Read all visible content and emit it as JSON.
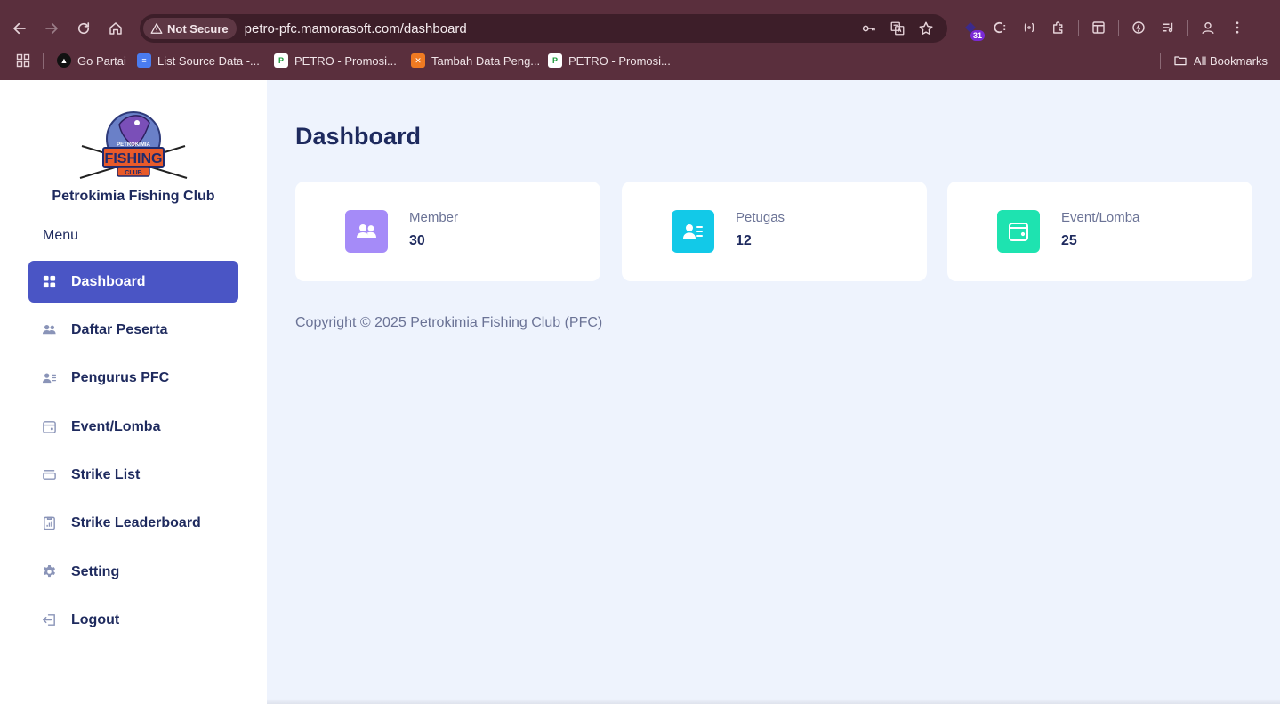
{
  "browser": {
    "security_label": "Not Secure",
    "url": "petro-pfc.mamorasoft.com/dashboard",
    "extension_badge": "31",
    "bookmarks": [
      {
        "label": "Go Partai",
        "favicon": "black-circle-icon",
        "color": "#111111"
      },
      {
        "label": "List Source Data -...",
        "favicon": "google-docs-icon",
        "color": "#4a7cf0"
      },
      {
        "label": "PETRO - Promosi...",
        "favicon": "petro-logo-icon",
        "color": "#ffffff"
      },
      {
        "label": "Tambah Data Peng...",
        "favicon": "xampp-icon",
        "color": "#f07a22"
      },
      {
        "label": "PETRO - Promosi...",
        "favicon": "petro-logo-icon",
        "color": "#ffffff"
      }
    ],
    "all_bookmarks_label": "All Bookmarks"
  },
  "sidebar": {
    "brand": "Petrokimia Fishing Club",
    "menu_label": "Menu",
    "items": [
      {
        "label": "Dashboard",
        "icon": "grid-icon"
      },
      {
        "label": "Daftar Peserta",
        "icon": "users-icon"
      },
      {
        "label": "Pengurus PFC",
        "icon": "id-card-icon"
      },
      {
        "label": "Event/Lomba",
        "icon": "calendar-icon"
      },
      {
        "label": "Strike List",
        "icon": "list-icon"
      },
      {
        "label": "Strike Leaderboard",
        "icon": "clipboard-chart-icon"
      },
      {
        "label": "Setting",
        "icon": "gear-icon"
      },
      {
        "label": "Logout",
        "icon": "logout-icon"
      }
    ],
    "active_item": "Dashboard"
  },
  "main": {
    "title": "Dashboard",
    "cards": [
      {
        "label": "Member",
        "value": "30",
        "icon": "users-icon",
        "color": "#a58bf8"
      },
      {
        "label": "Petugas",
        "value": "12",
        "icon": "id-card-icon",
        "color": "#12c9e8"
      },
      {
        "label": "Event/Lomba",
        "value": "25",
        "icon": "calendar-icon",
        "color": "#1ee3b0"
      }
    ],
    "footer": "Copyright © 2025 Petrokimia Fishing Club (PFC)"
  },
  "colors": {
    "accent": "#4a55c5",
    "heading": "#1e2a5e",
    "chrome": "#5a2f3d"
  }
}
